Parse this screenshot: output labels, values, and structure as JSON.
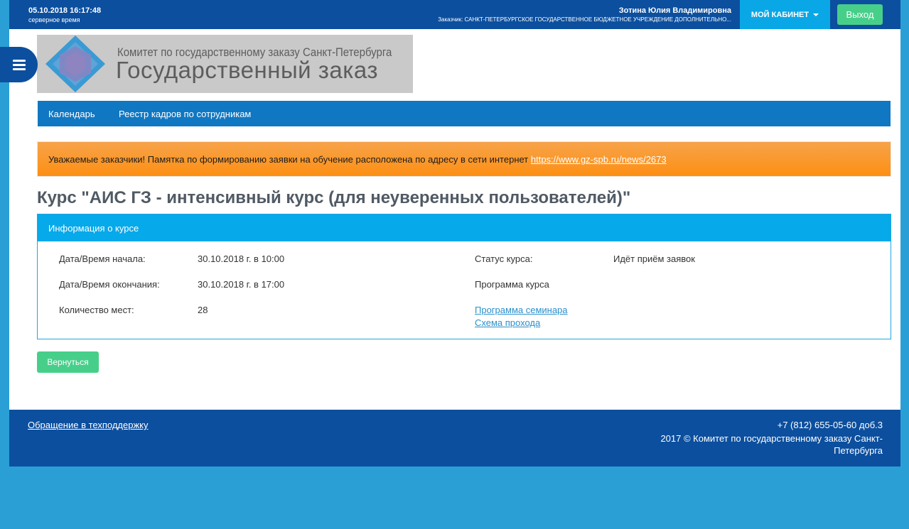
{
  "topbar": {
    "datetime": "05.10.2018 16:17:48",
    "server_time_label": "серверное время",
    "user_name": "Зотина Юлия Владимировна",
    "customer": "Заказчик: САНКТ-ПЕТЕРБУРГСКОЕ ГОСУДАРСТВЕННОЕ БЮДЖЕТНОЕ УЧРЕЖДЕНИЕ ДОПОЛНИТЕЛЬНО...",
    "cabinet_label": "МОЙ КАБИНЕТ",
    "logout_label": "Выход"
  },
  "logo": {
    "line1": "Комитет по государственному заказу Санкт-Петербурга",
    "line2": "Государственный заказ"
  },
  "nav": {
    "items": [
      {
        "label": "Календарь"
      },
      {
        "label": "Реестр кадров по сотрудникам"
      }
    ]
  },
  "alert": {
    "text": "Уважаемые заказчики! Памятка по формированию заявки на обучение расположена по адресу в сети интернет ",
    "link": "https://www.gz-spb.ru/news/2673"
  },
  "course": {
    "title": "Курс \"АИС ГЗ - интенсивный курс (для неуверенных пользователей)\""
  },
  "panel": {
    "heading": "Информация о курсе",
    "start_label": "Дата/Время начала:",
    "start_value": "30.10.2018 г. в 10:00",
    "end_label": "Дата/Время окончания:",
    "end_value": "30.10.2018 г. в 17:00",
    "seats_label": "Количество мест:",
    "seats_value": "28",
    "status_label": "Статус курса:",
    "status_value": "Идёт приём заявок",
    "program_label": "Программа курса",
    "program_link": "Программа семинара",
    "route_link": "Схема прохода"
  },
  "actions": {
    "back_label": "Вернуться"
  },
  "footer": {
    "support_link": "Обращение в техподдержку",
    "phone": "+7 (812) 655-05-60 доб.3",
    "copyright": "2017 © Комитет по государственному заказу Санкт-Петербурга"
  },
  "colors": {
    "header_blue": "#0c4f9e",
    "accent_cyan": "#06a9ea",
    "green_button": "#47cf8a",
    "alert_orange": "#fd8f12",
    "background": "#2a9fd6"
  },
  "icons": {
    "menu": "hamburger-icon",
    "cabinet_dropdown": "caret-down-icon",
    "logo_mark": "hexagon-logo-icon"
  }
}
